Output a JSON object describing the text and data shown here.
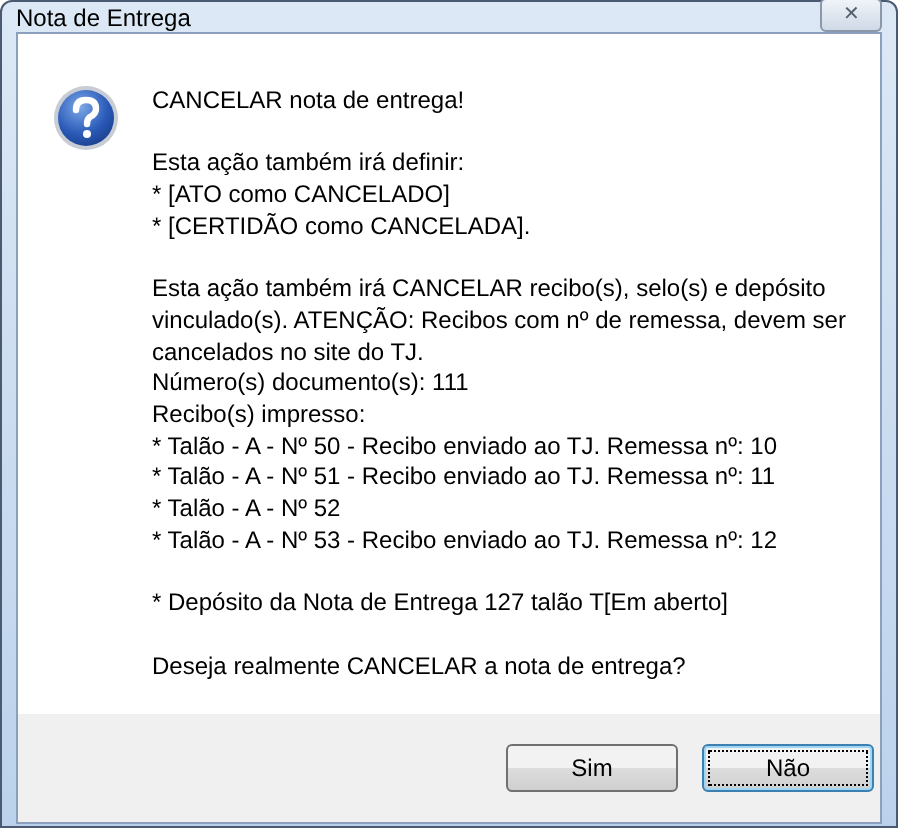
{
  "window": {
    "title": "Nota de Entrega",
    "close_label": "✕"
  },
  "message": {
    "paragraphs": [
      [
        "CANCELAR nota de entrega!"
      ],
      [
        "Esta ação também irá definir:",
        "* [ATO como CANCELADO]",
        "* [CERTIDÃO como CANCELADA]."
      ],
      [
        "Esta ação também irá CANCELAR recibo(s), selo(s) e depósito",
        "vinculado(s). ATENÇÃO: Recibos com nº de remessa, devem ser",
        "cancelados no site do TJ.",
        "Número(s) documento(s): 111",
        "Recibo(s) impresso:",
        "* Talão - A - Nº 50 - Recibo enviado ao TJ. Remessa nº: 10",
        "* Talão - A - Nº 51 - Recibo enviado ao TJ. Remessa nº: 11",
        "* Talão - A - Nº 52",
        "* Talão - A - Nº 53 - Recibo enviado ao TJ. Remessa nº: 12"
      ],
      [
        "* Depósito da Nota de Entrega 127 talão T[Em aberto]"
      ],
      [
        "Deseja realmente CANCELAR a nota de entrega?"
      ]
    ]
  },
  "buttons": [
    {
      "label": "Sim",
      "default": false
    },
    {
      "label": "Não",
      "default": true
    }
  ]
}
